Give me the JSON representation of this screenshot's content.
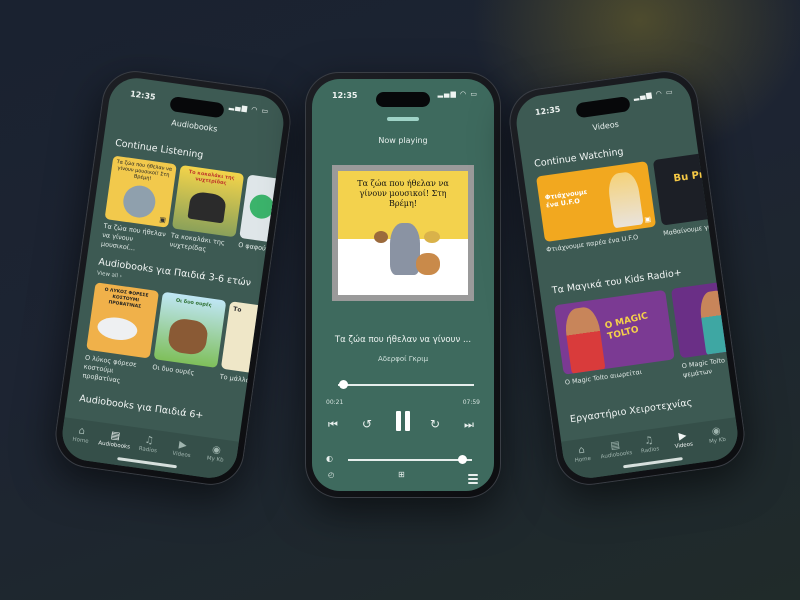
{
  "status_time": "12:35",
  "tabs": [
    "Home",
    "Audiobooks",
    "Radios",
    "Videos",
    "My Kb"
  ],
  "audiobooks_screen": {
    "header": "Audiobooks",
    "continue_title": "Continue Listening",
    "continue_items": [
      "Τα ζώα που ήθελαν να γίνουν μουσικοί...",
      "Τα κοκαλάκι της νυχτερίδας",
      "Ο φαφούτ αδερφός"
    ],
    "cover_texts": [
      "Τα ζώα που ήθελαν να γίνουν μουσικοί! Στη Βρέμη!",
      "Το κοκαλάκι της νυχτερίδας"
    ],
    "section2_title": "Audiobooks για Παιδιά 3-6 ετών",
    "view_all": "View all",
    "section2_items": [
      "Ο λύκος φόρεσε κοστούμι προβατίνας",
      "Οι δυο ουρές",
      "Το μάλλον"
    ],
    "section2_covers": [
      "Ο ΛΥΚΟΣ ΦΟΡΕΣΕ ΚΟΣΤΟΥΜΙ ΠΡΟΒΑΤΙΝΑΣ",
      "Οι δυο ουρές",
      "Το"
    ],
    "section3_title": "Audiobooks για Παιδιά 6+"
  },
  "player_screen": {
    "header": "Now playing",
    "cover_text": "Τα ζώα που ήθελαν να γίνουν μουσικοί! Στη Βρέμη!",
    "title": "Τα ζώα που ήθελαν να γίνουν ...",
    "author": "Αδερφοί Γκριμ",
    "elapsed": "00:21",
    "duration": "07:59",
    "progress": 0.04,
    "volume": 0.92
  },
  "videos_screen": {
    "header": "Videos",
    "continue_title": "Continue Watching",
    "continue_items": [
      "Φτιάχνουμε παρέα ένα U.F.O",
      "Μαθαίνουμε για"
    ],
    "thumb_texts": [
      "Φτιάχνουμε ένα U.F.O",
      "Bu Pro"
    ],
    "section2_title": "Τα Μαγικά του Kids Radio+",
    "section2_items": [
      "Ο Magic Tolto αιωρείται",
      "Ο Magic Tolto και ψεμάτων"
    ],
    "magic_thumb_text": "O MAGIC TOLTO",
    "section3_title": "Εργαστήριο Χειροτεχνίας"
  },
  "colors": {
    "screen": "#3d5a53",
    "accent_mint": "#9fd3c7",
    "tabbar": "#354f49"
  }
}
